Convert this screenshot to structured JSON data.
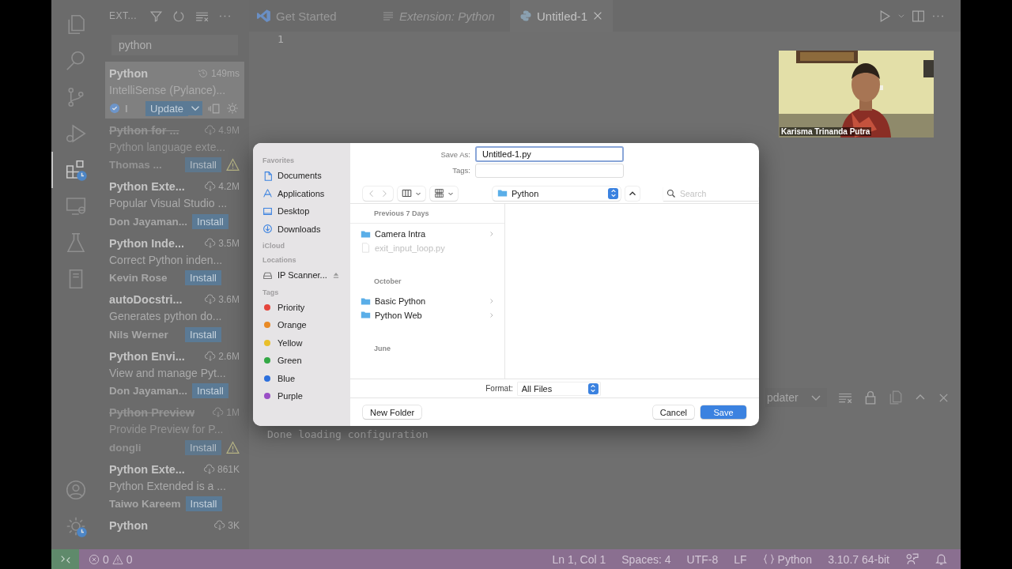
{
  "activity_top": [
    {
      "selected": false,
      "badge": false
    },
    {
      "selected": false,
      "badge": false
    },
    {
      "selected": false,
      "badge": false
    },
    {
      "selected": false,
      "badge": false
    },
    {
      "selected": true,
      "badge": true
    },
    {
      "selected": false,
      "badge": false
    },
    {
      "selected": false,
      "badge": false
    },
    {
      "selected": false,
      "badge": false
    }
  ],
  "activity_bottom": [
    {
      "selected": false,
      "badge": false
    },
    {
      "selected": false,
      "badge": true
    }
  ],
  "sidebar": {
    "title": "EXT...",
    "search": {
      "value": "python"
    },
    "extensions": [
      {
        "name": "Python",
        "kind": "installed",
        "count": "149ms",
        "description": "IntelliSense (Pylance)...",
        "publisher": "I",
        "verified": true,
        "action": "Update",
        "deprecated": false,
        "warning": false,
        "selected": true
      },
      {
        "name": "Python for ...",
        "kind": "marketplace",
        "count": "4.9M",
        "description": "Python language exte...",
        "publisher": "Thomas ...",
        "verified": false,
        "action": "Install",
        "deprecated": true,
        "warning": true,
        "selected": false
      },
      {
        "name": "Python Exte...",
        "kind": "marketplace",
        "count": "4.2M",
        "description": "Popular Visual Studio ...",
        "publisher": "Don Jayaman...",
        "verified": false,
        "action": "Install",
        "deprecated": false,
        "warning": false,
        "selected": false
      },
      {
        "name": "Python Inde...",
        "kind": "marketplace",
        "count": "3.5M",
        "description": "Correct Python inden...",
        "publisher": "Kevin Rose",
        "verified": false,
        "action": "Install",
        "deprecated": false,
        "warning": false,
        "selected": false
      },
      {
        "name": "autoDocstri...",
        "kind": "marketplace",
        "count": "3.6M",
        "description": "Generates python do...",
        "publisher": "Nils Werner",
        "verified": false,
        "action": "Install",
        "deprecated": false,
        "warning": false,
        "selected": false
      },
      {
        "name": "Python Envi...",
        "kind": "marketplace",
        "count": "2.6M",
        "description": "View and manage Pyt...",
        "publisher": "Don Jayaman...",
        "verified": false,
        "action": "Install",
        "deprecated": false,
        "warning": false,
        "selected": false
      },
      {
        "name": "Python Preview",
        "kind": "marketplace",
        "count": "1M",
        "description": "Provide Preview for P...",
        "publisher": "dongli",
        "verified": false,
        "action": "Install",
        "deprecated": true,
        "warning": true,
        "selected": false
      },
      {
        "name": "Python Exte...",
        "kind": "marketplace",
        "count": "861K",
        "description": "Python Extended is a ...",
        "publisher": "Taiwo Kareem",
        "verified": false,
        "action": "Install",
        "deprecated": false,
        "warning": false,
        "selected": false
      },
      {
        "name": "Python",
        "kind": "marketplace",
        "count": "3K",
        "deprecated": false,
        "selected": false
      }
    ]
  },
  "tabs": [
    {
      "label": "Get Started",
      "kind": "welcome",
      "italic": false,
      "selected": false
    },
    {
      "label": "Extension: Python",
      "kind": "preview",
      "italic": true,
      "selected": false
    },
    {
      "label": "Untitled-1",
      "kind": "python",
      "italic": false,
      "selected": true
    }
  ],
  "editor": {
    "line_numbers": [
      "1"
    ]
  },
  "webcam": {
    "caption": "Karisma Trinanda Putra"
  },
  "panel": {
    "channel": "pdater",
    "output": "Done loading configuration"
  },
  "dialog": {
    "sidebar": [
      {
        "heading": "Favorites",
        "items": [
          {
            "label": "Documents",
            "kind": "document"
          },
          {
            "label": "Applications",
            "kind": "apps"
          },
          {
            "label": "Desktop",
            "kind": "desktop"
          },
          {
            "label": "Downloads",
            "kind": "download"
          }
        ]
      },
      {
        "heading": "iCloud"
      },
      {
        "heading": "Locations",
        "items": [
          {
            "label": "IP Scanner...",
            "kind": "disk",
            "eject": true
          }
        ]
      },
      {
        "heading": "Tags",
        "items": [
          {
            "label": "Priority",
            "kind": "tag",
            "color": "#e5453c"
          },
          {
            "label": "Orange",
            "kind": "tag",
            "color": "#e98a25"
          },
          {
            "label": "Yellow",
            "kind": "tag",
            "color": "#e9bf2a"
          },
          {
            "label": "Green",
            "kind": "tag",
            "color": "#33a845"
          },
          {
            "label": "Blue",
            "kind": "tag",
            "color": "#2c6fdc"
          },
          {
            "label": "Purple",
            "kind": "tag",
            "color": "#9a4fc6"
          }
        ]
      }
    ],
    "save_as_label": "Save As:",
    "save_as_value": "Untitled-1.py",
    "tags_label": "Tags:",
    "location": "Python",
    "search_placeholder": "Search",
    "groups": [
      {
        "heading": "Previous 7 Days",
        "items": [
          {
            "name": "Camera Intra",
            "kind": "folder",
            "disabled": false
          },
          {
            "name": "exit_input_loop.py",
            "kind": "file",
            "disabled": true
          }
        ]
      },
      {
        "heading": "October",
        "items": [
          {
            "name": "Basic Python",
            "kind": "folder",
            "disabled": false
          },
          {
            "name": "Python Web",
            "kind": "folder",
            "disabled": false
          }
        ]
      },
      {
        "heading": "June"
      }
    ],
    "format_label": "Format:",
    "format_value": "All Files",
    "buttons": [
      {
        "label": "New Folder",
        "kind": "secondary"
      },
      {
        "label": "Cancel",
        "kind": "secondary"
      },
      {
        "label": "Save",
        "kind": "default"
      }
    ]
  },
  "status_bar": {
    "errors": "0",
    "warnings": "0",
    "items": [
      {
        "label": "Ln 1, Col 1",
        "kind": "text"
      },
      {
        "label": "Spaces: 4",
        "kind": "text"
      },
      {
        "label": "UTF-8",
        "kind": "text"
      },
      {
        "label": "LF",
        "kind": "text"
      },
      {
        "label": "Python",
        "kind": "language"
      },
      {
        "label": "3.10.7 64-bit",
        "kind": "text"
      }
    ]
  }
}
